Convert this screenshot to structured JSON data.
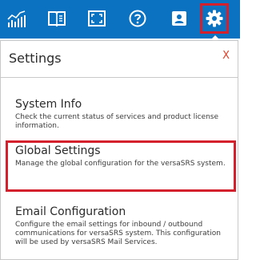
{
  "toolbar": {
    "background": "#0b72c1",
    "icons": [
      {
        "name": "analytics-icon"
      },
      {
        "name": "book-icon"
      },
      {
        "name": "fullscreen-icon"
      },
      {
        "name": "help-icon"
      },
      {
        "name": "contact-card-icon"
      },
      {
        "name": "gear-icon",
        "active": true
      }
    ]
  },
  "panel": {
    "title": "Settings",
    "close_label": "X",
    "items": [
      {
        "title": "System Info",
        "description": "Check the current status of services and product license information."
      },
      {
        "title": "Global Settings",
        "description": "Manage the global configuration for the versaSRS system.",
        "highlighted": true
      },
      {
        "title": "Email Configuration",
        "description": "Configure the email settings for inbound / outbound communications for versaSRS system. This configuration will be used by versaSRS Mail Services."
      }
    ]
  },
  "colors": {
    "highlight": "#d4202c",
    "close": "#e0412a"
  }
}
